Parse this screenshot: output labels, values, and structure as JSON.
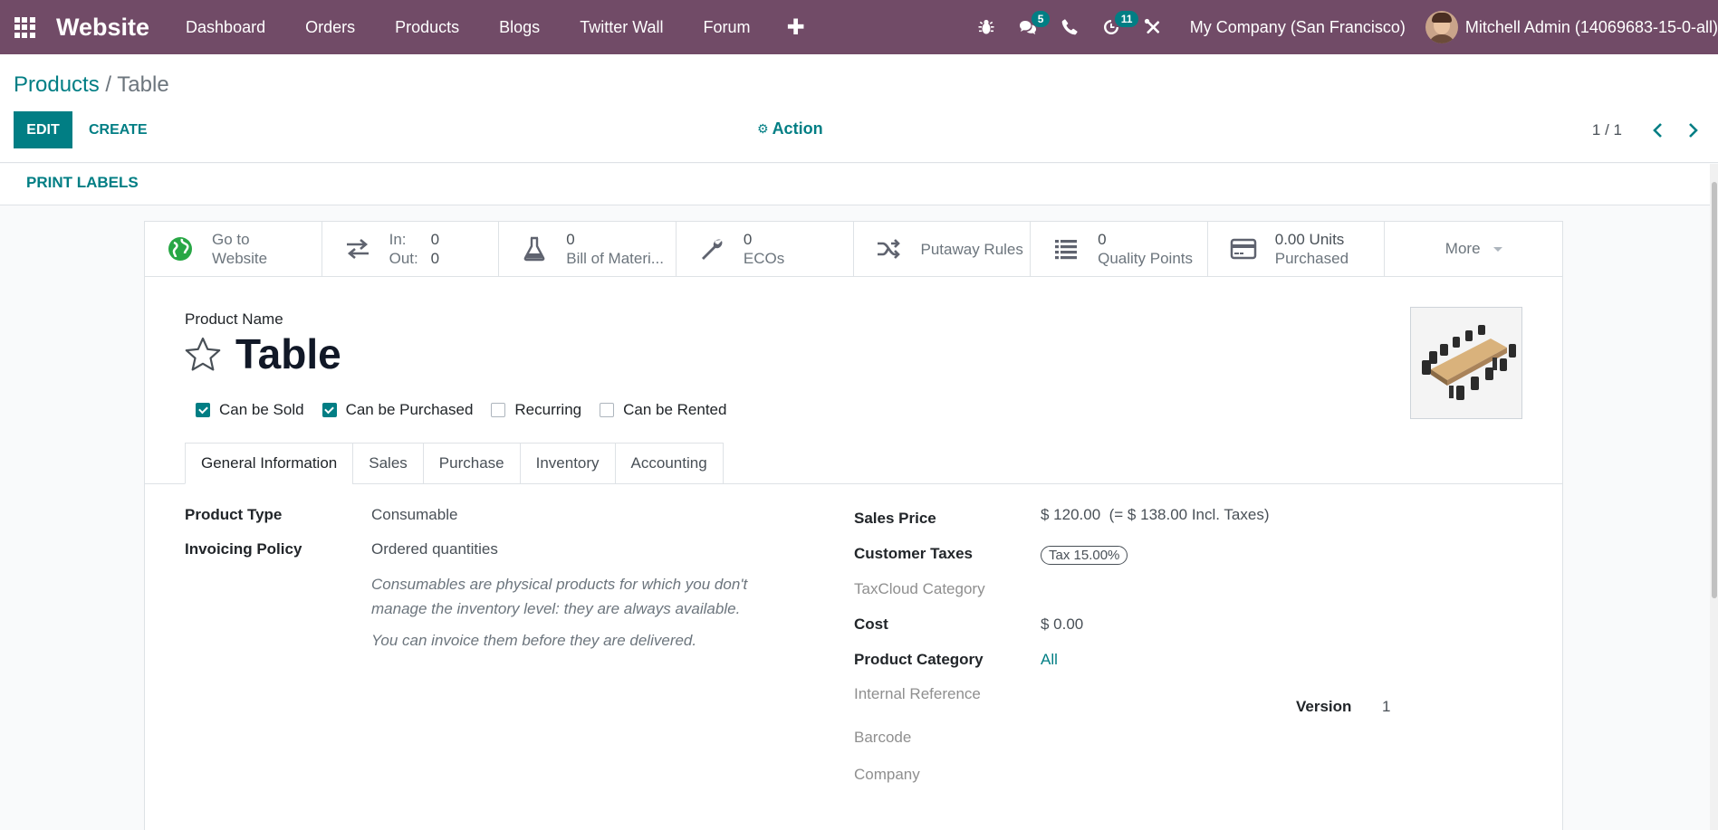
{
  "navbar": {
    "brand": "Website",
    "menu": [
      "Dashboard",
      "Orders",
      "Products",
      "Blogs",
      "Twitter Wall",
      "Forum"
    ],
    "plus_symbol": "✚",
    "messages_count": "5",
    "activities_count": "11",
    "company": "My Company (San Francisco)",
    "user": "Mitchell Admin (14069683-15-0-all)"
  },
  "breadcrumb": {
    "parent": "Products",
    "separator": " / ",
    "current": "Table"
  },
  "buttons": {
    "edit": "EDIT",
    "create": "CREATE",
    "action": "Action",
    "print_labels": "PRINT LABELS"
  },
  "pager": {
    "value": "1 / 1"
  },
  "smart_buttons": {
    "website": {
      "line1": "Go to",
      "line2": "Website"
    },
    "in_out": {
      "in_label": "In:",
      "in_value": "0",
      "out_label": "Out:",
      "out_value": "0"
    },
    "bom": {
      "value": "0",
      "label": "Bill of Materi..."
    },
    "ecos": {
      "value": "0",
      "label": "ECOs"
    },
    "putaway": {
      "label": "Putaway Rules"
    },
    "quality": {
      "value": "0",
      "label": "Quality Points"
    },
    "purchased": {
      "value": "0.00 Units",
      "label": "Purchased"
    },
    "more": {
      "label": "More"
    }
  },
  "product": {
    "name_label": "Product Name",
    "name": "Table",
    "checkboxes": [
      {
        "label": "Can be Sold",
        "checked": true
      },
      {
        "label": "Can be Purchased",
        "checked": true
      },
      {
        "label": "Recurring",
        "checked": false
      },
      {
        "label": "Can be Rented",
        "checked": false
      }
    ]
  },
  "tabs": [
    "General Information",
    "Sales",
    "Purchase",
    "Inventory",
    "Accounting"
  ],
  "general": {
    "product_type_label": "Product Type",
    "product_type": "Consumable",
    "invoicing_policy_label": "Invoicing Policy",
    "invoicing_policy": "Ordered quantities",
    "help1_line1": "Consumables are physical products for which you don't",
    "help1_line2": "manage the inventory level: they are always available.",
    "help2": "You can invoice them before they are delivered.",
    "sales_price_label": "Sales Price",
    "sales_price": "$ 120.00  (= $ 138.00 Incl. Taxes)",
    "customer_taxes_label": "Customer Taxes",
    "customer_taxes": "Tax 15.00%",
    "taxcloud_label": "TaxCloud Category",
    "cost_label": "Cost",
    "cost": "$ 0.00",
    "category_label": "Product Category",
    "category": "All",
    "internal_ref_label": "Internal Reference",
    "version_label": "Version",
    "version": "1",
    "barcode_label": "Barcode",
    "company_label": "Company"
  },
  "colors": {
    "navbar": "#714b67",
    "accent": "#017e84"
  }
}
